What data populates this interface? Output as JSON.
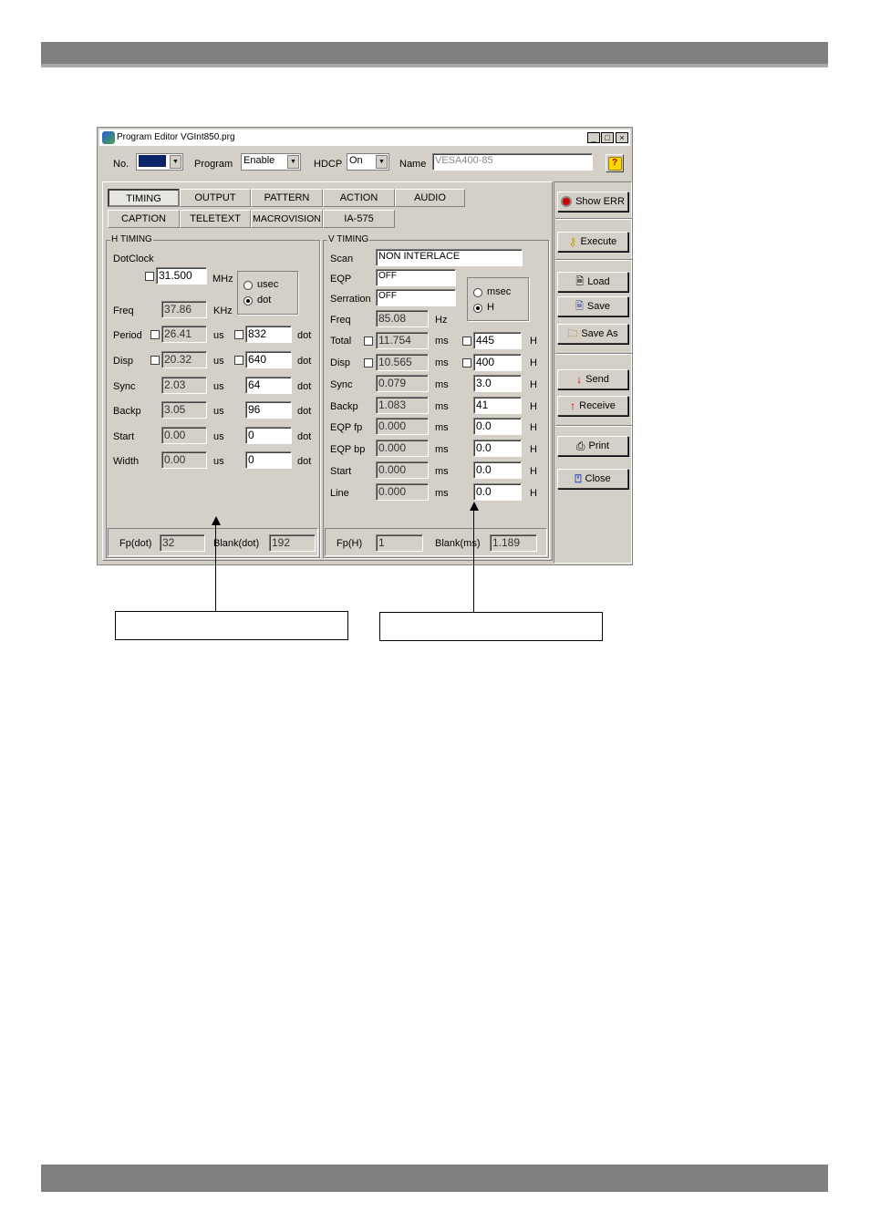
{
  "window": {
    "title": "Program Editor VGInt850.prg",
    "controls": [
      "_",
      "□",
      "×"
    ]
  },
  "top": {
    "no_label": "No.",
    "program_label": "Program",
    "program_value": "Enable",
    "hdcp_label": "HDCP",
    "hdcp_value": "On",
    "name_label": "Name",
    "name_value": "VESA400-85",
    "help_glyph": "?"
  },
  "tabs": [
    "TIMING",
    "OUTPUT",
    "PATTERN",
    "ACTION",
    "AUDIO",
    "CAPTION",
    "TELETEXT",
    "MACROVISION",
    "IA-575"
  ],
  "active_tab": "TIMING",
  "h_timing": {
    "title": "H TIMING",
    "dotclock_label": "DotClock",
    "dotclock_value": "31.500",
    "dotclock_unit": "MHz",
    "radio_usec": "usec",
    "radio_dot": "dot",
    "selected_radio": "dot",
    "rows": [
      {
        "label": "Freq",
        "value": "37.86",
        "unit": "KHz",
        "value2": "",
        "unit2": ""
      },
      {
        "label": "Period",
        "value": "26.41",
        "unit": "us",
        "value2": "832",
        "unit2": "dot"
      },
      {
        "label": "Disp",
        "value": "20.32",
        "unit": "us",
        "value2": "640",
        "unit2": "dot"
      },
      {
        "label": "Sync",
        "value": "2.03",
        "unit": "us",
        "value2": "64",
        "unit2": "dot"
      },
      {
        "label": "Backp",
        "value": "3.05",
        "unit": "us",
        "value2": "96",
        "unit2": "dot"
      },
      {
        "label": "Start",
        "value": "0.00",
        "unit": "us",
        "value2": "0",
        "unit2": "dot"
      },
      {
        "label": "Width",
        "value": "0.00",
        "unit": "us",
        "value2": "0",
        "unit2": "dot"
      }
    ],
    "fp_label": "Fp(dot)",
    "fp_value": "32",
    "blank_label": "Blank(dot)",
    "blank_value": "192"
  },
  "v_timing": {
    "title": "V TIMING",
    "scan_label": "Scan",
    "scan_value": "NON INTERLACE",
    "eqp_label": "EQP",
    "eqp_value": "OFF",
    "serration_label": "Serration",
    "serration_value": "OFF",
    "radio_msec": "msec",
    "radio_h": "H",
    "selected_radio": "H",
    "freq_label": "Freq",
    "freq_value": "85.08",
    "freq_unit": "Hz",
    "rows": [
      {
        "label": "Total",
        "value": "11.754",
        "unit": "ms",
        "value2": "445",
        "unit2": "H"
      },
      {
        "label": "Disp",
        "value": "10.565",
        "unit": "ms",
        "value2": "400",
        "unit2": "H"
      },
      {
        "label": "Sync",
        "value": "0.079",
        "unit": "ms",
        "value2": "3.0",
        "unit2": "H"
      },
      {
        "label": "Backp",
        "value": "1.083",
        "unit": "ms",
        "value2": "41",
        "unit2": "H"
      },
      {
        "label": "EQP fp",
        "value": "0.000",
        "unit": "ms",
        "value2": "0.0",
        "unit2": "H"
      },
      {
        "label": "EQP bp",
        "value": "0.000",
        "unit": "ms",
        "value2": "0.0",
        "unit2": "H"
      },
      {
        "label": "Start",
        "value": "0.000",
        "unit": "ms",
        "value2": "0.0",
        "unit2": "H"
      },
      {
        "label": "Line",
        "value": "0.000",
        "unit": "ms",
        "value2": "0.0",
        "unit2": "H"
      }
    ],
    "fp_label": "Fp(H)",
    "fp_value": "1",
    "blank_label": "Blank(ms)",
    "blank_value": "1.189"
  },
  "side_buttons": {
    "show_err": "Show ERR",
    "execute": "Execute",
    "load": "Load",
    "save": "Save",
    "save_as": "Save As",
    "send": "Send",
    "receive": "Receive",
    "print": "Print",
    "close": "Close"
  }
}
